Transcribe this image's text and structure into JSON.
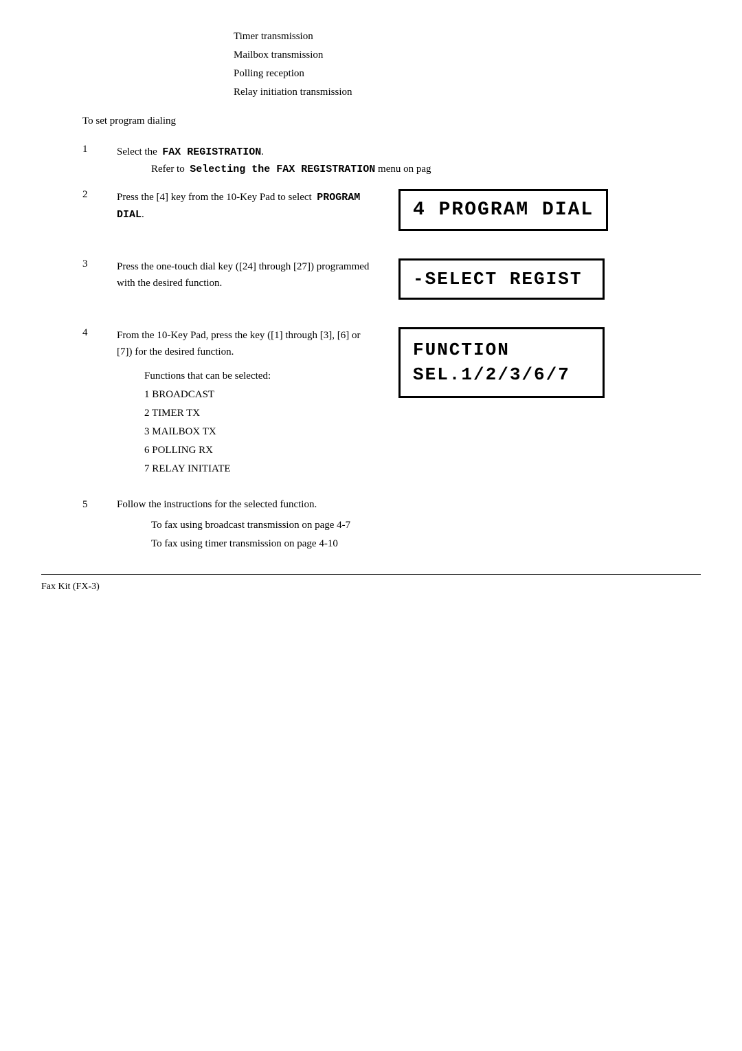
{
  "page": {
    "bullets": [
      "Timer transmission",
      "Mailbox transmission",
      "Polling reception",
      "Relay initiation transmission"
    ],
    "program_dialing_label": "To set program dialing",
    "steps": [
      {
        "number": "1",
        "text": "Select the",
        "text_mono": "FAX REGISTRATION",
        "text_period": ".",
        "sub_text": "Refer to",
        "sub_mono": "Selecting the  FAX REGISTRATION",
        "sub_suffix": " menu on pag"
      },
      {
        "number": "2",
        "text": "Press the [4] key from the 10-Key Pad to select",
        "text_mono": "PROGRAM DIAL",
        "text_period": ".",
        "lcd_line1": "4 PROGRAM DIAL"
      },
      {
        "number": "3",
        "text": "Press the one-touch dial key ([24] through [27]) programmed with the desired function.",
        "lcd_line1": "-SELECT REGIST"
      },
      {
        "number": "4",
        "text": "From the 10-Key Pad, press the key ([1] through [3], [6] or [7]) for the desired function.",
        "sub_label": "Functions that can be selected:",
        "functions": [
          "1 BROADCAST",
          "2 TIMER TX",
          "3 MAILBOX TX",
          "6 POLLING RX",
          "7 RELAY INITIATE"
        ],
        "lcd_line1": "FUNCTION",
        "lcd_line2": "SEL.1/2/3/6/7"
      },
      {
        "number": "5",
        "text": "Follow the instructions for the selected function.",
        "notes": [
          "To fax using broadcast transmission  on page 4-7",
          "To fax using timer transmission  on page 4-10"
        ]
      }
    ],
    "footer": "Fax Kit (FX-3)"
  }
}
